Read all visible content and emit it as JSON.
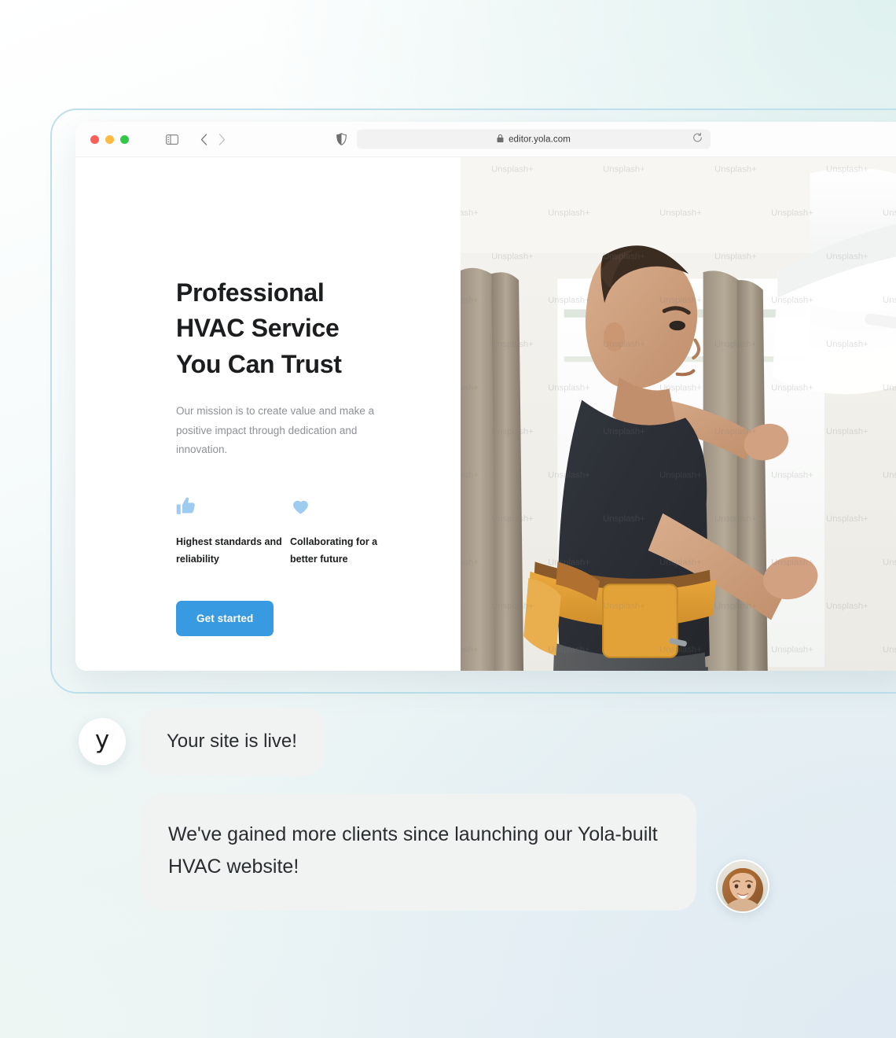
{
  "browser": {
    "url": "editor.yola.com",
    "traffic_lights": [
      "close",
      "minimize",
      "maximize"
    ],
    "icons": {
      "sidebar": "sidebar-toggle-icon",
      "back": "back-arrow-icon",
      "forward": "forward-arrow-icon",
      "shield": "privacy-shield-icon",
      "lock": "lock-icon",
      "reload": "reload-icon"
    }
  },
  "site": {
    "headline": "Professional HVAC Service You Can Trust",
    "headline_lines": [
      "Professional",
      "HVAC Service",
      "You Can Trust"
    ],
    "subcopy": "Our mission is to create value and make a positive impact through dedication and innovation.",
    "features": [
      {
        "icon": "thumbs-up-icon",
        "label": "Highest standards and reliability"
      },
      {
        "icon": "heart-icon",
        "label": "Collaborating for a better future"
      }
    ],
    "cta_label": "Get started",
    "hero_image": {
      "alt": "HVAC technician servicing a wall-mounted air conditioner",
      "watermark": "Unsplash+"
    }
  },
  "chat": {
    "messages": [
      {
        "avatar": "yola-logo",
        "avatar_text": "y",
        "text": "Your site is live!"
      },
      {
        "avatar": "customer-photo",
        "text": "We've gained more clients since launching our Yola-built HVAC website!"
      }
    ]
  },
  "colors": {
    "accent": "#389ae0",
    "feature_icon": "#9ecbf0",
    "bubble": "#f1f2f2",
    "heading": "#1b1d1f",
    "body_text": "#8d9296",
    "frame_border": "#bfe0ec"
  }
}
